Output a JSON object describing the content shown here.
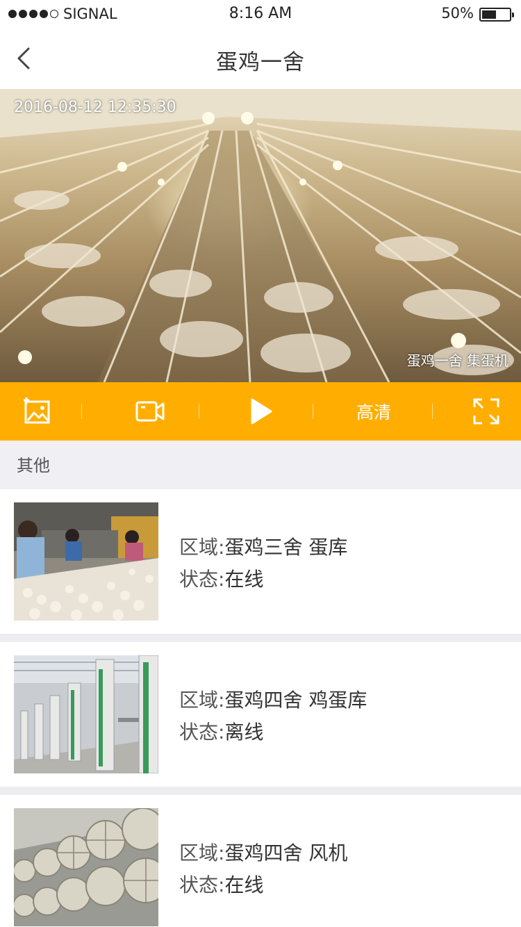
{
  "status_bar": {
    "carrier": "SIGNAL",
    "time": "8:16 AM",
    "battery": "50%",
    "battery_level": 0.5
  },
  "nav": {
    "title": "蛋鸡一舍"
  },
  "video": {
    "timestamp": "2016-08-12 12:35:30",
    "caption": "蛋鸡一舍 集蛋机"
  },
  "toolbar": {
    "quality_label": "高清",
    "icons": [
      "image-icon",
      "video-camera-icon",
      "play-icon",
      "fullscreen-icon"
    ],
    "accent_color": "#ffae00"
  },
  "section": {
    "title": "其他"
  },
  "devices": [
    {
      "area_label": "区域:",
      "area": "蛋鸡三舍 蛋库",
      "status_label": "状态:",
      "status": "在线"
    },
    {
      "area_label": "区域:",
      "area": "蛋鸡四舍 鸡蛋库",
      "status_label": "状态:",
      "status": "离线"
    },
    {
      "area_label": "区域:",
      "area": "蛋鸡四舍 风机",
      "status_label": "状态:",
      "status": "在线"
    }
  ]
}
